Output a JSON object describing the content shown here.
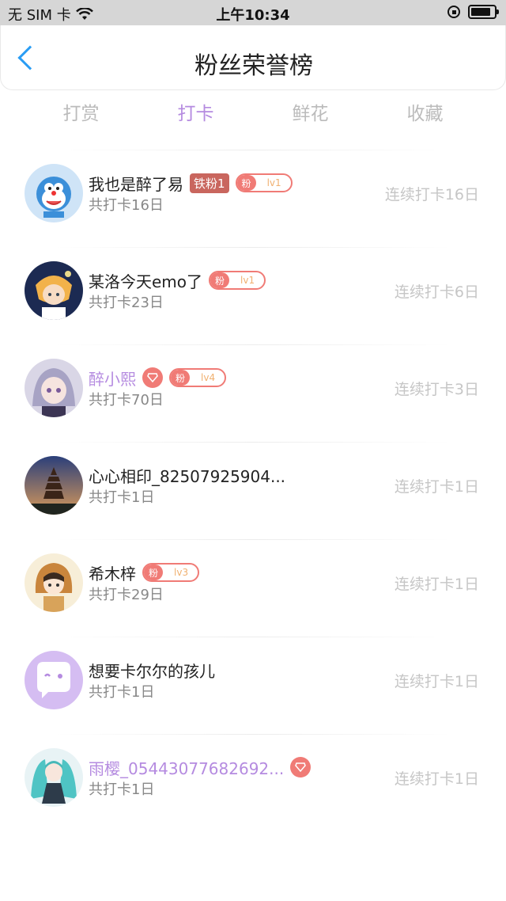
{
  "status": {
    "carrier": "无 SIM 卡",
    "time": "上午10:34",
    "battery_level": 0.85
  },
  "nav": {
    "title": "粉丝荣誉榜"
  },
  "tabs": [
    {
      "label": "打赏",
      "active": false
    },
    {
      "label": "打卡",
      "active": true
    },
    {
      "label": "鲜花",
      "active": false
    },
    {
      "label": "收藏",
      "active": false
    }
  ],
  "fans": [
    {
      "name": "我也是醉了易",
      "total": "共打卡16日",
      "streak": "连续打卡16日",
      "tie_badge": "铁粉1",
      "fan_tag": "粉",
      "level": "lv1"
    },
    {
      "name": "某洛今天emo了",
      "total": "共打卡23日",
      "streak": "连续打卡6日",
      "fan_tag": "粉",
      "level": "lv1"
    },
    {
      "name": "醉小熙",
      "total": "共打卡70日",
      "streak": "连续打卡3日",
      "fan_tag": "粉",
      "level": "lv4"
    },
    {
      "name": "心心相印_82507925904...",
      "total": "共打卡1日",
      "streak": "连续打卡1日"
    },
    {
      "name": "希木梓",
      "total": "共打卡29日",
      "streak": "连续打卡1日",
      "fan_tag": "粉",
      "level": "lv3"
    },
    {
      "name": "想要卡尔尔的孩儿",
      "total": "共打卡1日",
      "streak": "连续打卡1日"
    },
    {
      "name": "雨樱_05443077682692...",
      "total": "共打卡1日",
      "streak": "连续打卡1日"
    }
  ],
  "colors": {
    "accent_purple": "#b58be0",
    "back_blue": "#2a9df4",
    "fan_red": "#f07b76"
  }
}
